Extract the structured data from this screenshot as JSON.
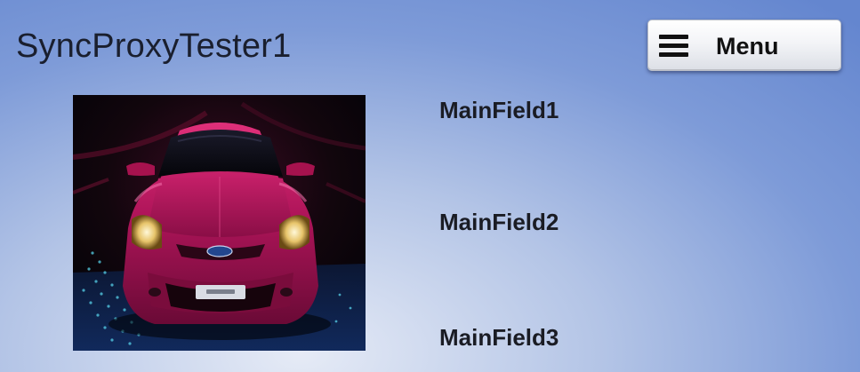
{
  "header": {
    "app_title": "SyncProxyTester1"
  },
  "menu_button": {
    "label": "Menu",
    "icon": "hamburger-menu-icon"
  },
  "graphic": {
    "description_icon": "car-image"
  },
  "main_fields": [
    {
      "text": "MainField1"
    },
    {
      "text": "MainField2"
    },
    {
      "text": "MainField3"
    }
  ],
  "colors": {
    "background_top": "#6486cf",
    "background_glow": "#e6ebf6",
    "car_body": "#b0155a",
    "text_dark": "#1a1c24"
  }
}
